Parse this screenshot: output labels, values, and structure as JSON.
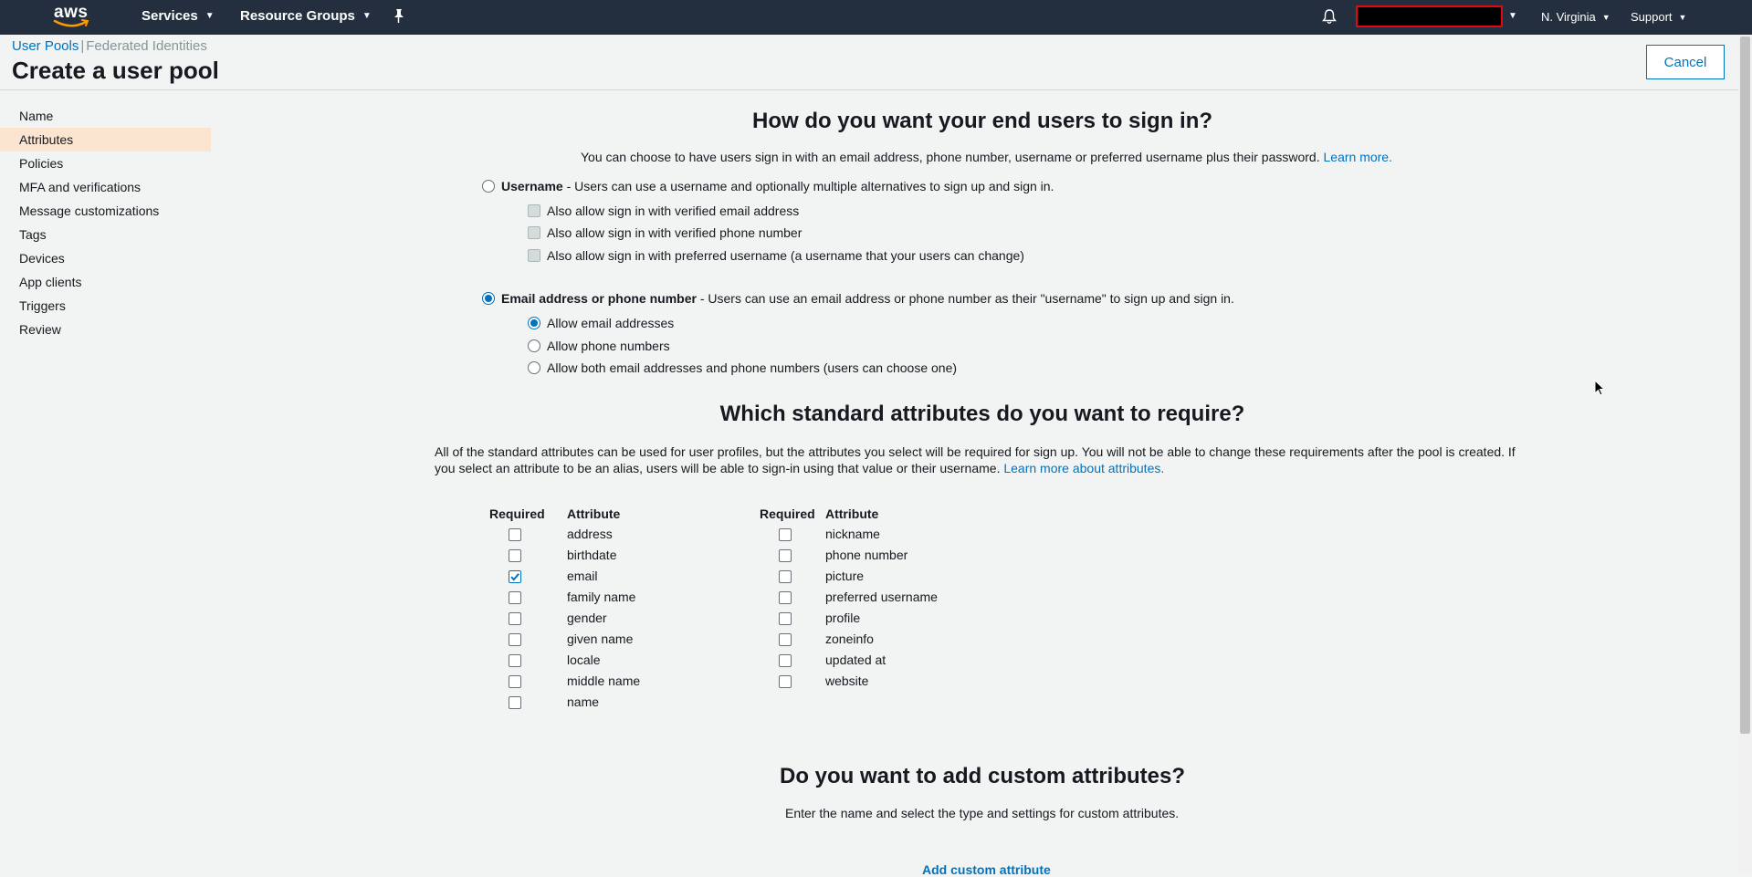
{
  "nav": {
    "logo_text": "aws",
    "services_label": "Services",
    "resource_groups_label": "Resource Groups",
    "region_label": "N. Virginia",
    "support_label": "Support"
  },
  "breadcrumb": {
    "user_pools": "User Pools",
    "separator": "|",
    "federated": "Federated Identities"
  },
  "page_title": "Create a user pool",
  "cancel_label": "Cancel",
  "sidebar": {
    "items": [
      {
        "label": "Name"
      },
      {
        "label": "Attributes",
        "active": true
      },
      {
        "label": "Policies"
      },
      {
        "label": "MFA and verifications"
      },
      {
        "label": "Message customizations"
      },
      {
        "label": "Tags"
      },
      {
        "label": "Devices"
      },
      {
        "label": "App clients"
      },
      {
        "label": "Triggers"
      },
      {
        "label": "Review"
      }
    ]
  },
  "signin": {
    "heading": "How do you want your end users to sign in?",
    "intro": "You can choose to have users sign in with an email address, phone number, username or preferred username plus their password.",
    "learn_more": "Learn more.",
    "username_title": "Username",
    "username_desc": " - Users can use a username and optionally multiple alternatives to sign up and sign in.",
    "username_selected": false,
    "username_options": [
      {
        "label": "Also allow sign in with verified email address",
        "checked": false
      },
      {
        "label": "Also allow sign in with verified phone number",
        "checked": false
      },
      {
        "label": "Also allow sign in with preferred username (a username that your users can change)",
        "checked": false
      }
    ],
    "email_title": "Email address or phone number",
    "email_desc": " - Users can use an email address or phone number as their \"username\" to sign up and sign in.",
    "email_selected": true,
    "email_options": [
      {
        "label": "Allow email addresses",
        "selected": true
      },
      {
        "label": "Allow phone numbers",
        "selected": false
      },
      {
        "label": "Allow both email addresses and phone numbers (users can choose one)",
        "selected": false
      }
    ]
  },
  "attributes": {
    "heading": "Which standard attributes do you want to require?",
    "description": "All of the standard attributes can be used for user profiles, but the attributes you select will be required for sign up. You will not be able to change these requirements after the pool is created. If you select an attribute to be an alias, users will be able to sign-in using that value or their username.",
    "learn_more": "Learn more about attributes.",
    "col_required": "Required",
    "col_attribute": "Attribute",
    "left": [
      {
        "name": "address",
        "required": false
      },
      {
        "name": "birthdate",
        "required": false
      },
      {
        "name": "email",
        "required": true
      },
      {
        "name": "family name",
        "required": false
      },
      {
        "name": "gender",
        "required": false
      },
      {
        "name": "given name",
        "required": false
      },
      {
        "name": "locale",
        "required": false
      },
      {
        "name": "middle name",
        "required": false
      },
      {
        "name": "name",
        "required": false
      }
    ],
    "right": [
      {
        "name": "nickname",
        "required": false
      },
      {
        "name": "phone number",
        "required": false
      },
      {
        "name": "picture",
        "required": false
      },
      {
        "name": "preferred username",
        "required": false
      },
      {
        "name": "profile",
        "required": false
      },
      {
        "name": "zoneinfo",
        "required": false
      },
      {
        "name": "updated at",
        "required": false
      },
      {
        "name": "website",
        "required": false
      }
    ]
  },
  "custom": {
    "heading": "Do you want to add custom attributes?",
    "description": "Enter the name and select the type and settings for custom attributes.",
    "add_label": "Add custom attribute"
  },
  "colors": {
    "nav_bg": "#232f3e",
    "link": "#0073bb",
    "active_sidebar": "#fbe4d0",
    "page_bg": "#f2f3f3"
  },
  "icons": [
    "aws-logo",
    "pin-icon",
    "bell-icon",
    "chevron-down-icon",
    "check-icon",
    "mouse-cursor"
  ]
}
